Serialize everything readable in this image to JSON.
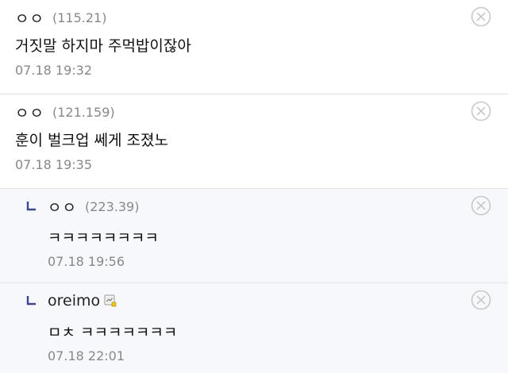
{
  "comments": [
    {
      "nickname": "ㅇㅇ",
      "ip": "(115.21)",
      "text": "거짓말 하지마 주먹밥이잖아",
      "date": "07.18 19:32",
      "delete_icon": "close-circle-icon"
    },
    {
      "nickname": "ㅇㅇ",
      "ip": "(121.159)",
      "text": "훈이 벌크업 쎄게 조졌노",
      "date": "07.18 19:35",
      "delete_icon": "close-circle-icon"
    },
    {
      "nickname": "ㅇㅇ",
      "ip": "(223.39)",
      "text": "ㅋㅋㅋㅋㅋㅋㅋㅋ",
      "date": "07.18 19:56",
      "delete_icon": "close-circle-icon",
      "reply_icon": "reply-arrow-icon"
    },
    {
      "nickname": "oreimo",
      "text": "ㅁㅊ ㅋㅋㅋㅋㅋㅋㅋ",
      "date": "07.18 22:01",
      "delete_icon": "close-circle-icon",
      "reply_icon": "reply-arrow-icon",
      "badge_icon": "member-badge-icon"
    }
  ],
  "colors": {
    "reply_arrow": "#3b4890",
    "meta_text": "#888888",
    "reply_background": "#f7f8fb",
    "divider": "#e2e2e2",
    "delete_icon": "#c8c8c8"
  }
}
